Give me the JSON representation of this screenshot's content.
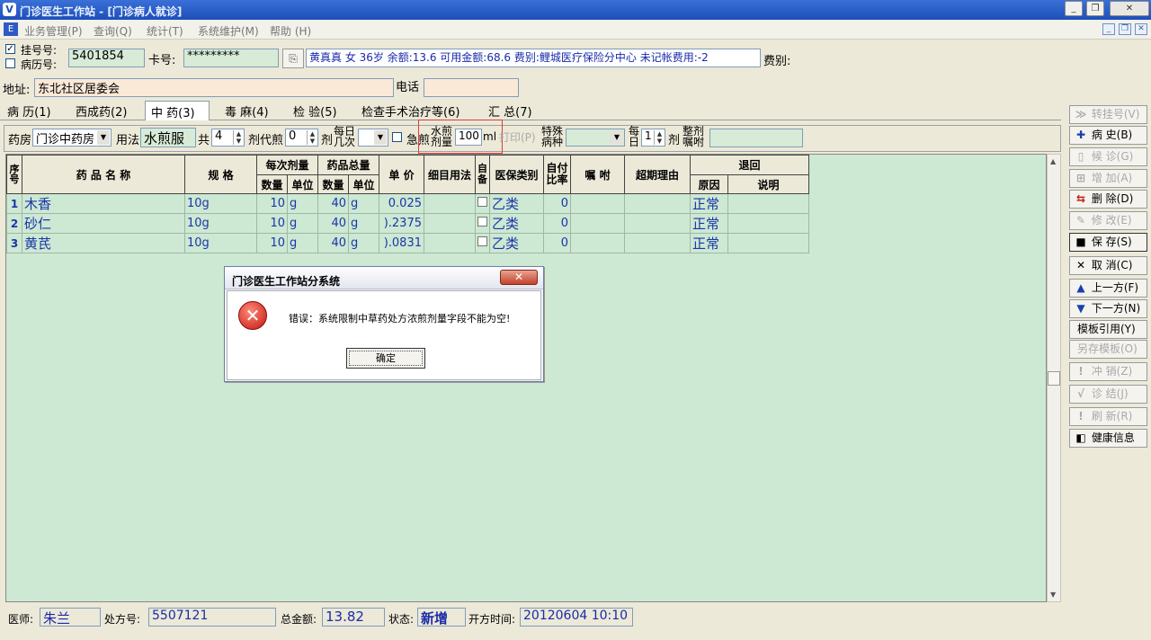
{
  "window": {
    "title": "门诊医生工作站 - [门诊病人就诊]",
    "minimize_icon": "minimize-icon",
    "restore_icon": "restore-icon",
    "close_icon": "close-icon"
  },
  "menu": [
    "业务管理(P)",
    "查询(Q)",
    "统计(T)",
    "系统维护(M)",
    "帮助 (H)"
  ],
  "header": {
    "reg_no_label": "挂号号:",
    "case_no_label": "病历号:",
    "reg_no_checked": true,
    "case_no_checked": false,
    "reg_no_value": "5401854",
    "card_label": "卡号:",
    "card_value": "*********",
    "patient_info": "黄真真  女  36岁 余额:13.6 可用金额:68.6 费别:鲤城医疗保险分中心 未记帐费用:-2",
    "fee_type_label": "费别:",
    "address_label": "地址:",
    "address_value": "东北社区居委会",
    "phone_label": "电话",
    "phone_value": ""
  },
  "tabs": [
    "病 历(1)",
    "西成药(2)",
    "中 药(3)",
    "毒 麻(4)",
    "检 验(5)",
    "检查手术治疗等(6)",
    "汇 总(7)"
  ],
  "active_tab": 2,
  "rx_toolbar": {
    "pharmacy_label": "药房",
    "pharmacy_value": "门诊中药房",
    "usage_label": "用法",
    "usage_value": "水煎服",
    "total_label": "共",
    "total_value": "4",
    "dose_label": "剂代煎",
    "dose_value": "0",
    "dose_unit": "剂",
    "daily_times_label": "每日几次",
    "daily_times_value": "",
    "first_decoct_label": "急煎",
    "water_dose_label": "水煎剂量",
    "water_dose_value": "100",
    "water_dose_unit": "ml",
    "print_label": "打印(P)",
    "special_disease_label": "特殊病种",
    "special_disease_value": "",
    "daily_label": "每日",
    "daily_value": "1",
    "daily_unit": "剂",
    "whole_advice_label": "整剂嘱咐",
    "whole_advice_value": ""
  },
  "grid": {
    "headers": {
      "seq": "序号",
      "name": "药 品 名 称",
      "spec": "规  格",
      "per_dose": "每次剂量",
      "total_qty": "药品总量",
      "qty": "数量",
      "unit": "单位",
      "price": "单 价",
      "detail_usage": "细目用法",
      "self_prep": "自备",
      "insurance": "医保类别",
      "self_pay": "自付比率",
      "advice": "嘱 咐",
      "exceed_reason": "超期理由",
      "return": "退回",
      "reason": "原因",
      "note": "说明"
    },
    "rows": [
      {
        "seq": "1",
        "name": "木香",
        "spec": "10g",
        "dose_qty": "10",
        "dose_unit": "g",
        "total_qty": "40",
        "total_unit": "g",
        "price": "0.025",
        "insurance": "乙类",
        "self_pay": "0",
        "reason": "正常"
      },
      {
        "seq": "2",
        "name": "砂仁",
        "spec": "10g",
        "dose_qty": "10",
        "dose_unit": "g",
        "total_qty": "40",
        "total_unit": "g",
        "price": ").2375",
        "insurance": "乙类",
        "self_pay": "0",
        "reason": "正常"
      },
      {
        "seq": "3",
        "name": "黄芪",
        "spec": "10g",
        "dose_qty": "10",
        "dose_unit": "g",
        "total_qty": "40",
        "total_unit": "g",
        "price": ").0831",
        "insurance": "乙类",
        "self_pay": "0",
        "reason": "正常"
      }
    ]
  },
  "side_buttons": [
    {
      "label": "转挂号(V)",
      "icon": "transfer-icon",
      "enabled": false
    },
    {
      "label": "病  史(B)",
      "icon": "plus-icon",
      "enabled": true
    },
    {
      "label": "候  诊(G)",
      "icon": "document-icon",
      "enabled": false
    },
    {
      "label": "增  加(A)",
      "icon": "add-icon",
      "enabled": false
    },
    {
      "label": "删  除(D)",
      "icon": "delete-icon",
      "enabled": true
    },
    {
      "label": "修  改(E)",
      "icon": "edit-icon",
      "enabled": false
    },
    {
      "label": "保  存(S)",
      "icon": "save-icon",
      "enabled": true
    },
    {
      "label": "取  消(C)",
      "icon": "cancel-icon",
      "enabled": true
    },
    {
      "label": "上一方(F)",
      "icon": "up-arrow-icon",
      "enabled": true
    },
    {
      "label": "下一方(N)",
      "icon": "down-arrow-icon",
      "enabled": true
    },
    {
      "label": "模板引用(Y)",
      "icon": "",
      "enabled": true
    },
    {
      "label": "另存模板(O)",
      "icon": "",
      "enabled": false
    },
    {
      "label": "冲  销(Z)",
      "icon": "exclamation-icon",
      "enabled": false
    },
    {
      "label": "诊  结(J)",
      "icon": "check-icon",
      "enabled": false
    },
    {
      "label": "刷  新(R)",
      "icon": "exclamation-icon",
      "enabled": false
    },
    {
      "label": "健康信息",
      "icon": "health-icon",
      "enabled": true
    }
  ],
  "status": {
    "doctor_label": "医师:",
    "doctor_value": "朱兰",
    "rx_no_label": "处方号:",
    "rx_no_value": "5507121",
    "total_label": "总金额:",
    "total_value": "13.82",
    "state_label": "状态:",
    "state_value": "新增",
    "time_label": "开方时间:",
    "time_value": "20120604 10:10"
  },
  "dialog": {
    "title": "门诊医生工作站分系统",
    "close_label": "✕",
    "message": "错误：系统限制中草药处方浓煎剂量字段不能为空!",
    "ok_label": "确定",
    "icon": "error-icon"
  }
}
